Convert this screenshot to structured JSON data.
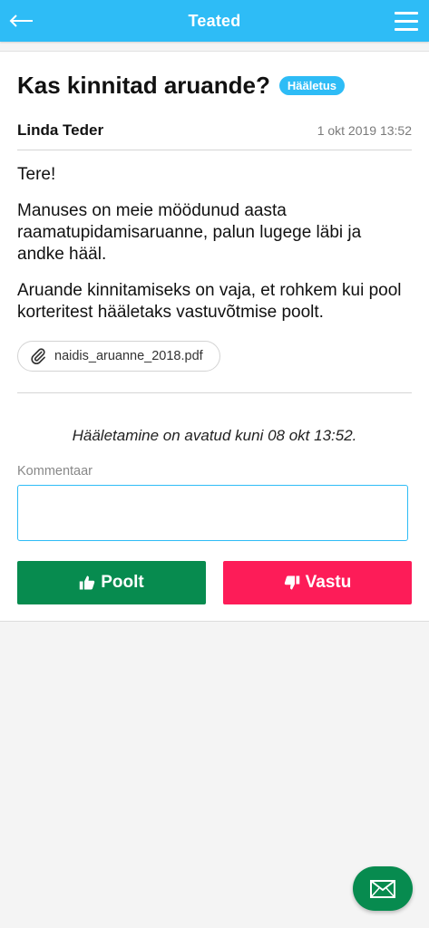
{
  "header": {
    "title": "Teated",
    "back_icon": "arrow-left-icon",
    "menu_icon": "hamburger-menu-icon",
    "color": "#2ebcf6"
  },
  "post": {
    "title": "Kas kinnitad aruande?",
    "tag": "Hääletus",
    "author": "Linda Teder",
    "date": "1 okt 2019 13:52",
    "paragraphs": [
      "Tere!",
      "Manuses on meie möödunud aasta raamatupidamisaruanne, palun lugege läbi ja andke hääl.",
      "Aruande kinnitamiseks on vaja, et rohkem kui pool korteritest hääletaks vastuvõtmise poolt."
    ],
    "attachment": {
      "filename": "naidis_aruanne_2018.pdf",
      "icon": "paperclip-icon"
    }
  },
  "voting": {
    "deadline_text": "Hääletamine on avatud kuni 08 okt 13:52.",
    "comment_label": "Kommentaar",
    "comment_value": "",
    "yes_label": "Poolt",
    "yes_icon": "thumbs-up-icon",
    "yes_color": "#078b4f",
    "no_label": "Vastu",
    "no_icon": "thumbs-down-icon",
    "no_color": "#fd1c58"
  },
  "fab": {
    "icon": "envelope-icon",
    "color": "#078b4f"
  }
}
